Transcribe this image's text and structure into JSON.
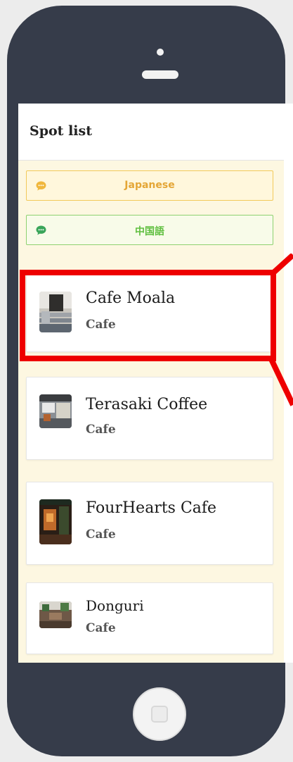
{
  "app": {
    "header_title": "Spot list"
  },
  "language_buttons": [
    {
      "label": "Japanese",
      "icon": "chat-bubble-icon",
      "color": "#e4a636"
    },
    {
      "label": "中国語",
      "icon": "chat-bubble-icon",
      "color": "#5fbf3f"
    }
  ],
  "spots": [
    {
      "name": "Cafe Moala",
      "category": "Cafe"
    },
    {
      "name": "Terasaki Coffee",
      "category": "Cafe"
    },
    {
      "name": "FourHearts Cafe",
      "category": "Cafe"
    },
    {
      "name": "Donguri",
      "category": "Cafe"
    }
  ],
  "colors": {
    "phone_body": "#363c4a",
    "screen_bg": "#fdf7e1",
    "highlight": "#ee0000"
  }
}
